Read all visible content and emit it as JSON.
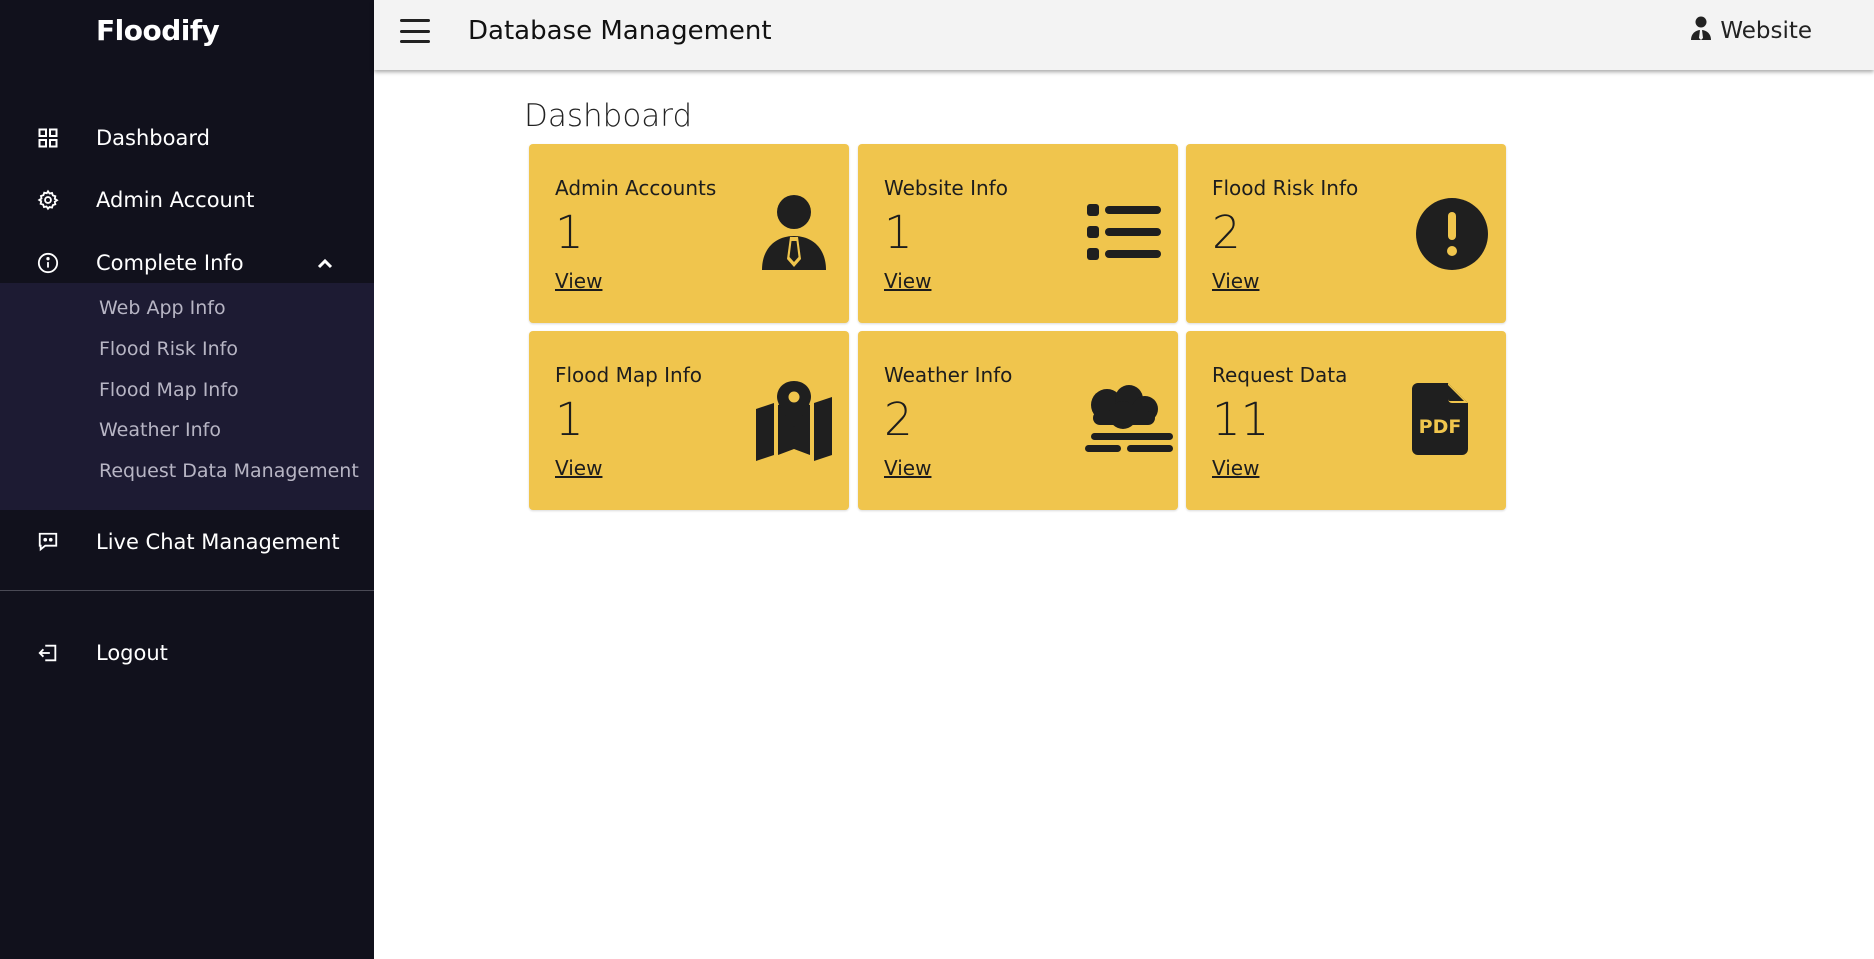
{
  "sidebar": {
    "brand": "Floodify",
    "items": {
      "dashboard": {
        "label": "Dashboard",
        "icon": "grid-icon"
      },
      "admin_account": {
        "label": "Admin Account",
        "icon": "gear-icon"
      },
      "complete_info": {
        "label": "Complete Info",
        "icon": "info-icon",
        "expanded": true
      },
      "live_chat": {
        "label": "Live Chat Management",
        "icon": "chat-icon"
      },
      "logout": {
        "label": "Logout",
        "icon": "logout-icon"
      }
    },
    "submenu": [
      "Web App Info",
      "Flood Risk Info",
      "Flood Map Info",
      "Weather Info",
      "Request Data Management"
    ]
  },
  "topbar": {
    "title": "Database Management",
    "user_label": "Website"
  },
  "main": {
    "page_title": "Dashboard",
    "cards": [
      {
        "title": "Admin Accounts",
        "value": "1",
        "link": "View",
        "icon": "user-tie-icon"
      },
      {
        "title": "Website Info",
        "value": "1",
        "link": "View",
        "icon": "list-icon"
      },
      {
        "title": "Flood Risk Info",
        "value": "2",
        "link": "View",
        "icon": "exclamation-circle-icon"
      },
      {
        "title": "Flood Map Info",
        "value": "1",
        "link": "View",
        "icon": "map-location-icon"
      },
      {
        "title": "Weather Info",
        "value": "2",
        "link": "View",
        "icon": "cloud-fog-icon"
      },
      {
        "title": "Request Data",
        "value": "11",
        "link": "View",
        "icon": "pdf-file-icon"
      }
    ]
  },
  "colors": {
    "sidebar_bg": "#11111c",
    "submenu_bg": "#1d1b33",
    "card_bg": "#f0c54d",
    "topbar_bg": "#f3f3f3"
  }
}
